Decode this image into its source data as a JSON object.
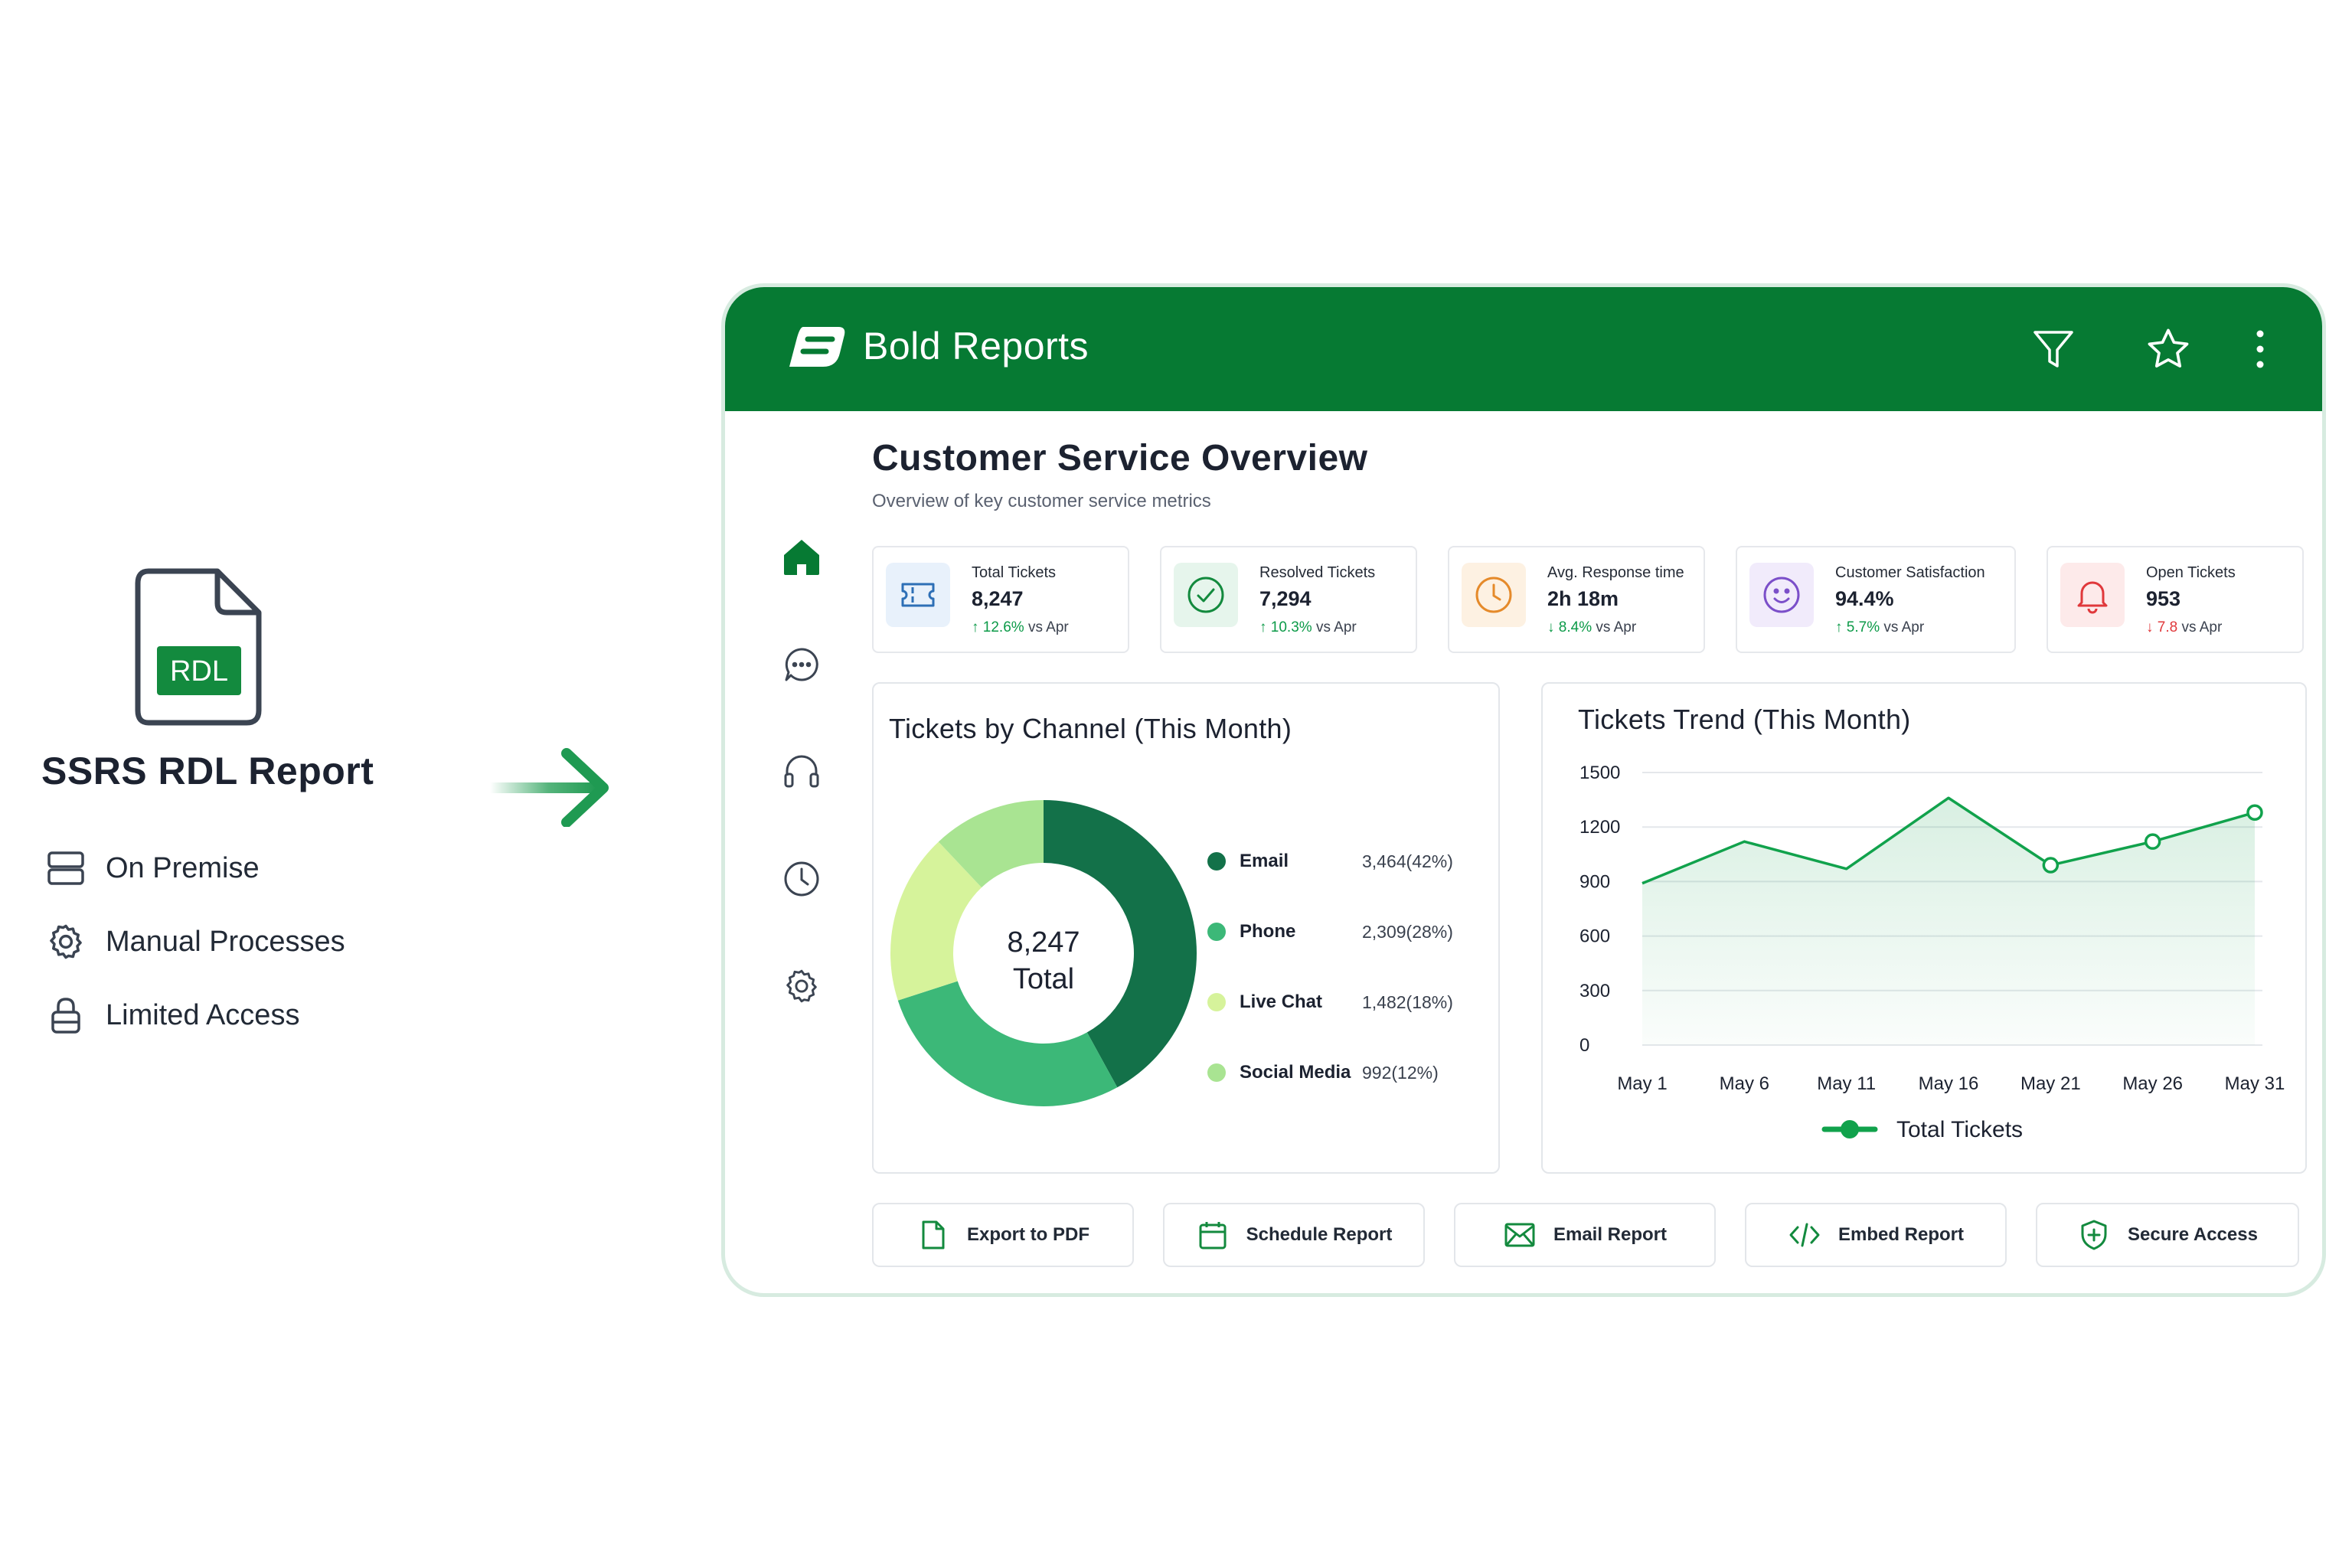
{
  "promo": {
    "file_badge": "RDL",
    "title": "SSRS RDL Report",
    "features": [
      {
        "icon": "server-icon",
        "label": "On Premise"
      },
      {
        "icon": "gear-icon",
        "label": "Manual Processes"
      },
      {
        "icon": "lock-icon",
        "label": "Limited Access"
      }
    ],
    "arrow_icon": "arrow-right-icon"
  },
  "app": {
    "brand": "Bold Reports",
    "toolbar_icons": [
      "filter-icon",
      "star-icon",
      "more-vertical-icon"
    ],
    "nav_icons": [
      "home-icon",
      "chat-icon",
      "headset-icon",
      "clock-icon",
      "settings-icon"
    ],
    "page_title": "Customer Service Overview",
    "page_subtitle": "Overview of key customer service metrics",
    "kpis": [
      {
        "icon": "ticket-icon",
        "label": "Total Tickets",
        "value": "8,247",
        "arrow": "↑",
        "delta": "12.6%",
        "suffix": "vs Apr",
        "trend": "up"
      },
      {
        "icon": "check-circle-icon",
        "label": "Resolved Tickets",
        "value": "7,294",
        "arrow": "↑",
        "delta": "10.3%",
        "suffix": "vs Apr",
        "trend": "up"
      },
      {
        "icon": "clock-icon",
        "label": "Avg. Response time",
        "value": "2h 18m",
        "arrow": "↓",
        "delta": "8.4%",
        "suffix": "vs Apr",
        "trend": "up"
      },
      {
        "icon": "smile-icon",
        "label": "Customer Satisfaction",
        "value": "94.4%",
        "arrow": "↑",
        "delta": "5.7%",
        "suffix": "vs Apr",
        "trend": "up"
      },
      {
        "icon": "bell-icon",
        "label": "Open Tickets",
        "value": "953",
        "arrow": "↓",
        "delta": "7.8",
        "suffix": "vs Apr",
        "trend": "down"
      }
    ],
    "actions": [
      {
        "icon": "file-icon",
        "label": "Export to PDF"
      },
      {
        "icon": "calendar-icon",
        "label": "Schedule Report"
      },
      {
        "icon": "mail-icon",
        "label": "Email Report"
      },
      {
        "icon": "code-icon",
        "label": "Embed Report"
      },
      {
        "icon": "shield-icon",
        "label": "Secure Access"
      }
    ],
    "colors": {
      "brand": "#067a33",
      "email": "#137149",
      "phone": "#3cb878",
      "live_chat": "#d6f39b",
      "social_media": "#a9e492",
      "line": "#11a24c"
    }
  },
  "chart_data": [
    {
      "type": "pie",
      "title": "Tickets by Channel (This Month)",
      "center_value": "8,247",
      "center_label": "Total",
      "categories": [
        "Email",
        "Phone",
        "Live Chat",
        "Social Media"
      ],
      "values": [
        3464,
        2309,
        1482,
        992
      ],
      "value_labels": [
        "3,464(42%)",
        "2,309(28%)",
        "1,482(18%)",
        "992(12%)"
      ]
    },
    {
      "type": "area",
      "title": "Tickets Trend (This Month)",
      "x_ticks": [
        "May 1",
        "May 6",
        "May 11",
        "May 16",
        "May 21",
        "May 26",
        "May 31"
      ],
      "y_ticks": [
        1500,
        1200,
        900,
        600,
        300,
        0
      ],
      "ylim": [
        0,
        1500
      ],
      "grid": true,
      "series": [
        {
          "name": "Total Tickets",
          "x": [
            "May 1",
            "May 6",
            "May 11",
            "May 16",
            "May 21",
            "May 26",
            "May 31"
          ],
          "values": [
            890,
            1120,
            970,
            1360,
            990,
            1120,
            1280
          ],
          "markers": [
            false,
            false,
            false,
            false,
            true,
            true,
            true
          ]
        }
      ],
      "legend": "bottom"
    }
  ]
}
